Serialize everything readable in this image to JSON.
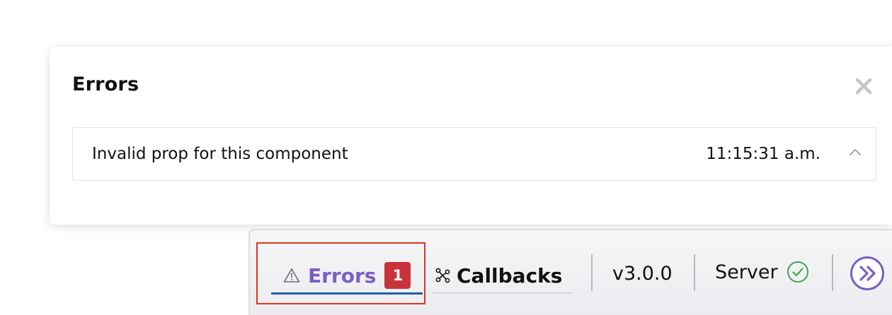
{
  "error_panel": {
    "title": "Errors",
    "close_icon": "close-icon",
    "errors": [
      {
        "message": "Invalid prop for this component",
        "time": "11:15:31 a.m.",
        "toggle_icon": "chevron-up-icon"
      }
    ]
  },
  "devtools_bar": {
    "errors_tab": {
      "icon": "warning-triangle-icon",
      "label": "Errors",
      "count": "1",
      "active": true
    },
    "callbacks_tab": {
      "icon": "callbacks-graph-icon",
      "label": "Callbacks"
    },
    "version": "v3.0.0",
    "server": {
      "label": "Server",
      "status_icon": "check-circle-icon"
    },
    "expand_icon": "double-chevron-right-icon"
  },
  "colors": {
    "accent_purple": "#7b5fc4",
    "active_underline": "#1e5fa8",
    "badge_red": "#c8333b",
    "status_green": "#3da64a",
    "highlight_red": "#e0321e"
  }
}
